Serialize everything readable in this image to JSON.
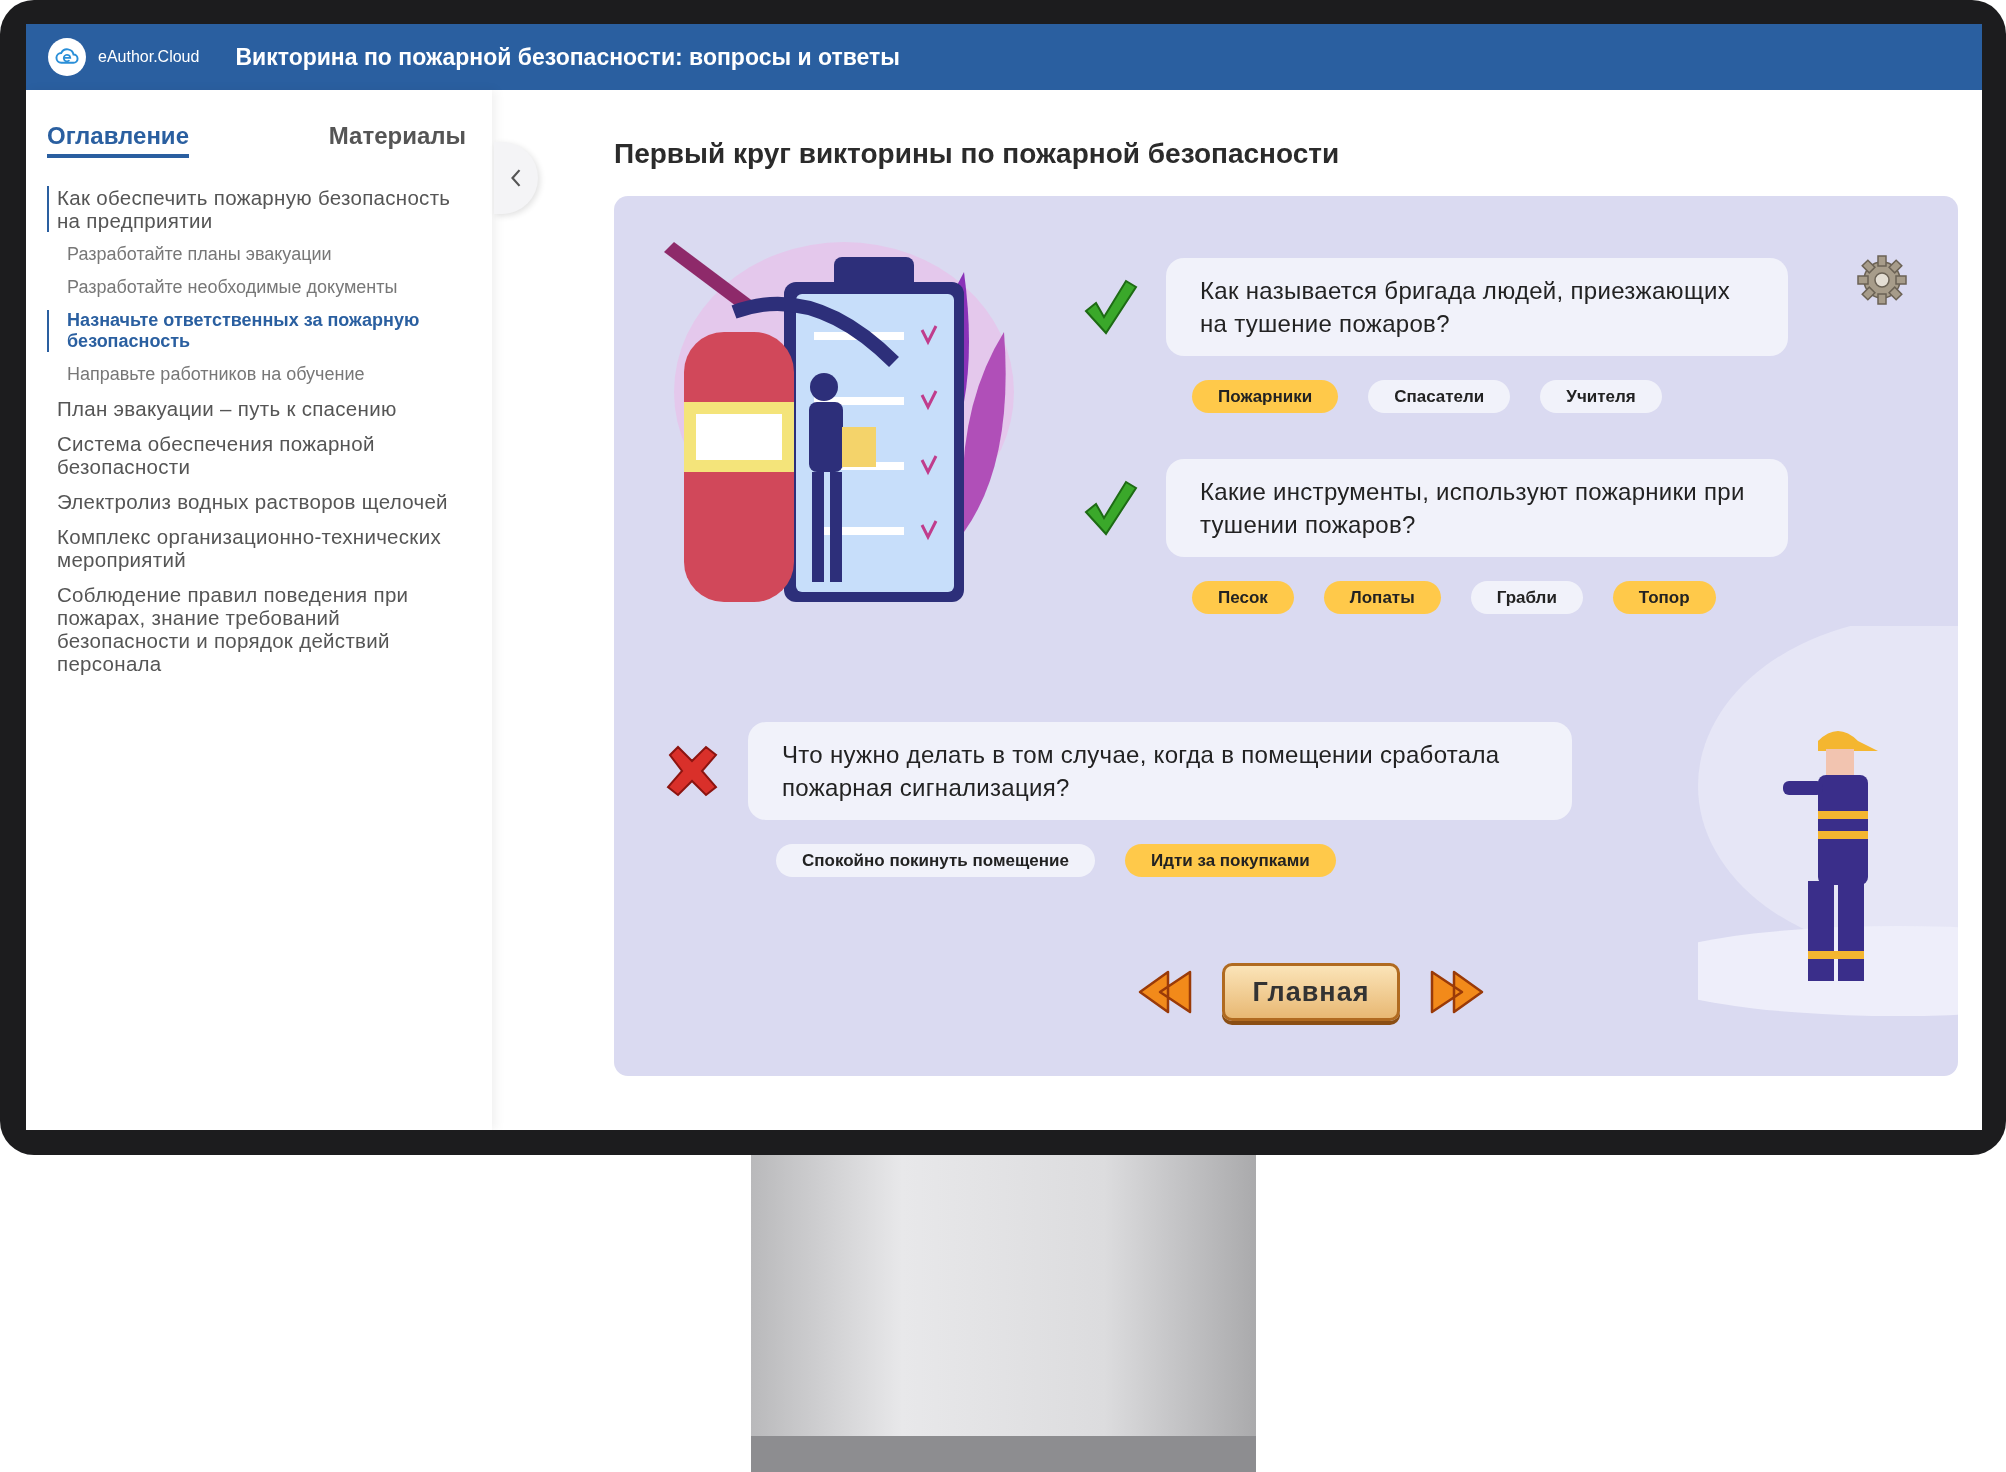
{
  "header": {
    "logo_text": "eAuthor.Cloud",
    "title": "Викторина по пожарной безопасности: вопросы и ответы"
  },
  "sidebar": {
    "tabs": [
      {
        "label": "Оглавление",
        "selected": true
      },
      {
        "label": "Материалы",
        "selected": false
      }
    ],
    "toc": [
      {
        "label": "Как обеспечить пожарную безопасность на предприятии",
        "selected": false,
        "children": [
          {
            "label": "Разработайте планы эвакуации",
            "selected": false
          },
          {
            "label": "Разработайте необходимые документы",
            "selected": false
          },
          {
            "label": "Назначьте ответственных за пожарную безопасность",
            "selected": true
          },
          {
            "label": "Направьте работников на обучение",
            "selected": false
          }
        ]
      },
      {
        "label": "План эвакуации – путь к спасению",
        "selected": false
      },
      {
        "label": "Система обеспечения пожарной безопасности",
        "selected": false
      },
      {
        "label": "Электролиз водных растворов щелочей",
        "selected": false
      },
      {
        "label": "Комплекс организационно-технических мероприятий",
        "selected": false
      },
      {
        "label": "Соблюдение правил поведения при пожарах, знание требований безопасности и порядок действий персонала",
        "selected": false
      }
    ]
  },
  "main": {
    "title": "Первый круг викторины по пожарной безопасности",
    "questions": [
      {
        "correct": true,
        "text": "Как называется бригада людей, приезжающих на тушение пожаров?",
        "answers": [
          {
            "label": "Пожарники",
            "selected": true
          },
          {
            "label": "Спасатели",
            "selected": false
          },
          {
            "label": "Учителя",
            "selected": false
          }
        ]
      },
      {
        "correct": true,
        "text": "Какие инструменты, используют пожарники при тушении пожаров?",
        "answers": [
          {
            "label": "Песок",
            "selected": true
          },
          {
            "label": "Лопаты",
            "selected": true
          },
          {
            "label": "Грабли",
            "selected": false
          },
          {
            "label": "Топор",
            "selected": true
          }
        ]
      },
      {
        "correct": false,
        "text": "Что нужно делать в том случае, когда в помещении сработала пожарная сигнализация?",
        "answers": [
          {
            "label": "Спокойно покинуть помещение",
            "selected": false
          },
          {
            "label": "Идти за покупками",
            "selected": true
          }
        ]
      }
    ],
    "home_button": "Главная"
  }
}
